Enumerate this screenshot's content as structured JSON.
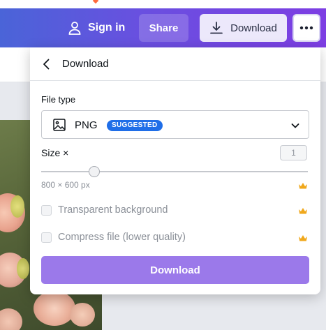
{
  "header": {
    "sign_in_label": "Sign in",
    "share_label": "Share",
    "download_label": "Download"
  },
  "panel": {
    "title": "Download",
    "file_type_label": "File type",
    "file_type_value": "PNG",
    "suggested_badge": "SUGGESTED",
    "size_label": "Size ×",
    "size_value": "1",
    "size_fraction": 0.2,
    "dimensions": "800 × 600 px",
    "transparent_label": "Transparent background",
    "compress_label": "Compress file (lower quality)",
    "download_button": "Download"
  },
  "colors": {
    "accent": "#9b79ea",
    "badge": "#1f6ee8",
    "crown": "#f0a81c"
  }
}
